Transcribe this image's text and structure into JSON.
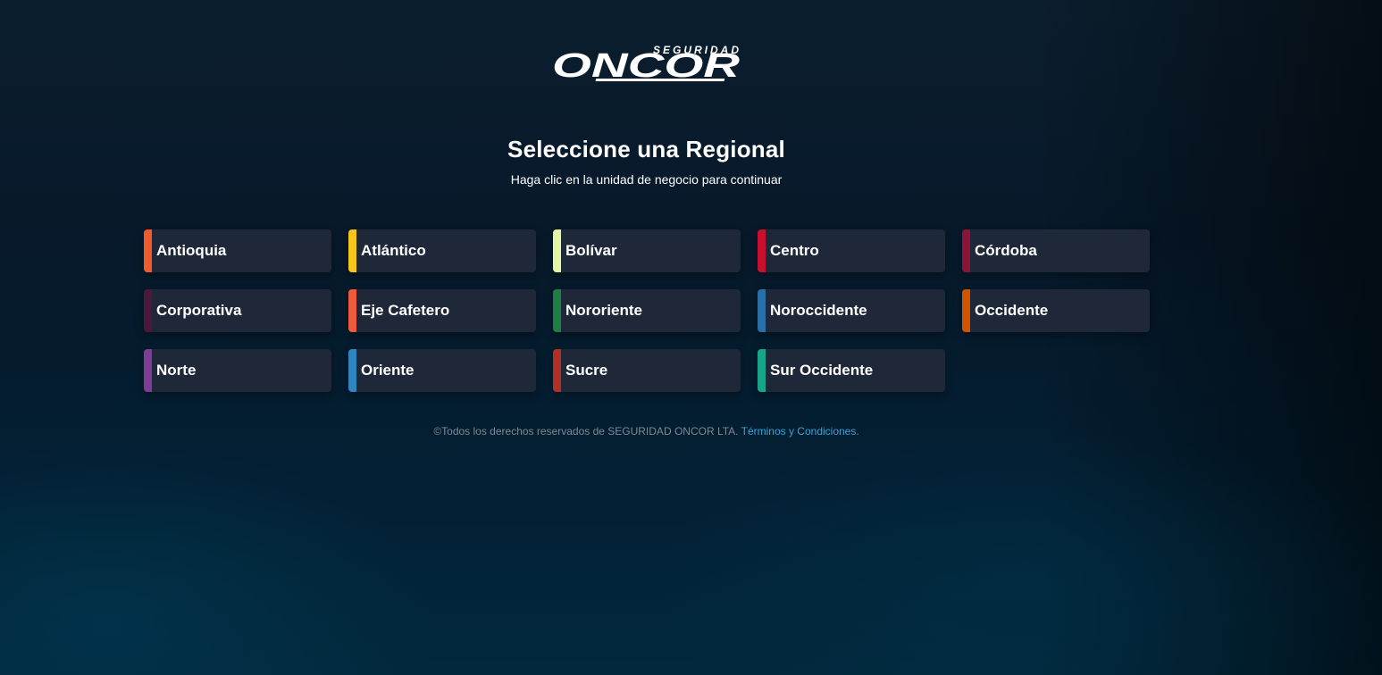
{
  "logo": {
    "top_text": "SEGURIDAD",
    "main_text": "ONCOR",
    "alt": "Seguridad Oncor logo"
  },
  "header": {
    "title": "Seleccione una Regional",
    "subtitle": "Haga clic en la unidad de negocio para continuar"
  },
  "regionals": [
    {
      "label": "Antioquia",
      "color": "#f15a2b"
    },
    {
      "label": "Atlántico",
      "color": "#f5c518"
    },
    {
      "label": "Bolívar",
      "color": "#e2f5a2"
    },
    {
      "label": "Centro",
      "color": "#c8102e"
    },
    {
      "label": "Córdoba",
      "color": "#8a1538"
    },
    {
      "label": "Corporativa",
      "color": "#4a1838"
    },
    {
      "label": "Eje Cafetero",
      "color": "#f05a3c"
    },
    {
      "label": "Nororiente",
      "color": "#1e7e45"
    },
    {
      "label": "Noroccidente",
      "color": "#2a6fa8"
    },
    {
      "label": "Occidente",
      "color": "#d35400"
    },
    {
      "label": "Norte",
      "color": "#7d3c98"
    },
    {
      "label": "Oriente",
      "color": "#2e86c1"
    },
    {
      "label": "Sucre",
      "color": "#b03028"
    },
    {
      "label": "Sur Occidente",
      "color": "#17a589"
    }
  ],
  "footer": {
    "text": "©Todos los derechos reservados de SEGURIDAD ONCOR LTA.",
    "link_label": "Términos y Condiciones",
    "trailing": "."
  }
}
